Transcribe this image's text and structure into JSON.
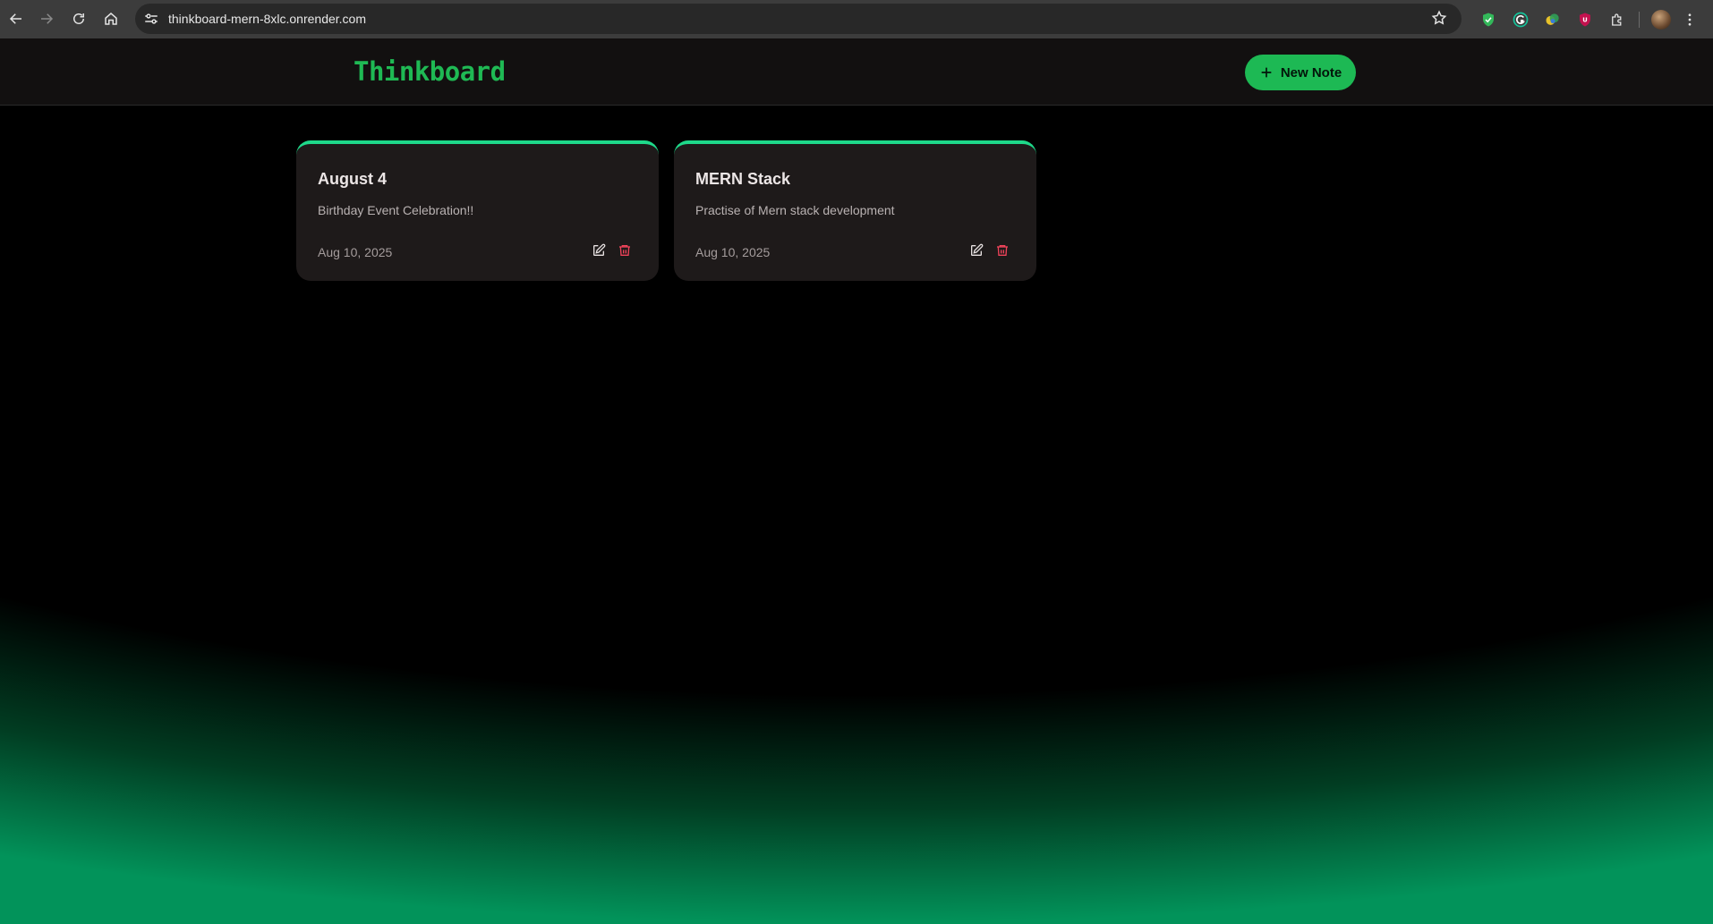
{
  "browser": {
    "url": "thinkboard-mern-8xlc.onrender.com",
    "extensions": [
      "shield-check-icon",
      "grammarly-icon",
      "colorful-extension-icon",
      "ublock-icon",
      "puzzle-extensions-icon"
    ]
  },
  "app": {
    "brand": "Thinkboard",
    "new_note_label": "New Note",
    "accent_color": "#1db954",
    "card_accent_color": "#1ed98a",
    "delete_color": "#f0435a"
  },
  "notes": [
    {
      "title": "August 4",
      "content": "Birthday Event Celebration!!",
      "date": "Aug 10, 2025"
    },
    {
      "title": "MERN Stack",
      "content": "Practise of Mern stack development",
      "date": "Aug 10, 2025"
    }
  ]
}
